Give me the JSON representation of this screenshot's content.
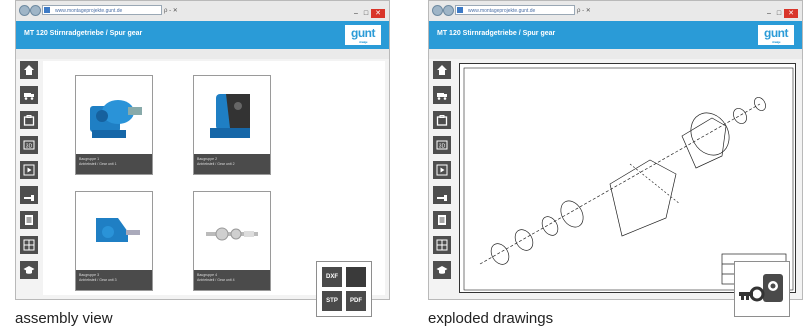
{
  "browser": {
    "url": "www.montageprojekte.gunt.de",
    "addr_controls": "ρ - ✕",
    "win_min": "–",
    "win_max": "□",
    "win_close": "✕",
    "app_title": "MT 120 Stirnradgetriebe / Spur gear",
    "logo_text": "gunt",
    "logo_sub": "Anzeige"
  },
  "left_panel": {
    "caption": "assembly view",
    "cards": [
      {
        "line1": "Baugruppe 1",
        "line2": "Antriebsteil / Gear unit 1"
      },
      {
        "line1": "Baugruppe 2",
        "line2": "Antriebsteil / Gear unit 2"
      },
      {
        "line1": "Baugruppe 3",
        "line2": "Antriebsteil / Gear unit 3"
      },
      {
        "line1": "Baugruppe 4",
        "line2": "Antriebsteil / Gear unit 4"
      }
    ],
    "formats": [
      "DXF",
      "STP",
      "PDF"
    ]
  },
  "right_panel": {
    "caption": "exploded drawings"
  },
  "sidebar_icons": [
    "home-icon",
    "truck-icon",
    "bag-icon",
    "3d-icon",
    "play-icon",
    "tools-icon",
    "document-icon",
    "grid-icon",
    "graduation-icon"
  ],
  "colors": {
    "accent": "#2a9bd7",
    "sidebar": "#4e4e4e",
    "part_blue": "#1f7fc4"
  }
}
